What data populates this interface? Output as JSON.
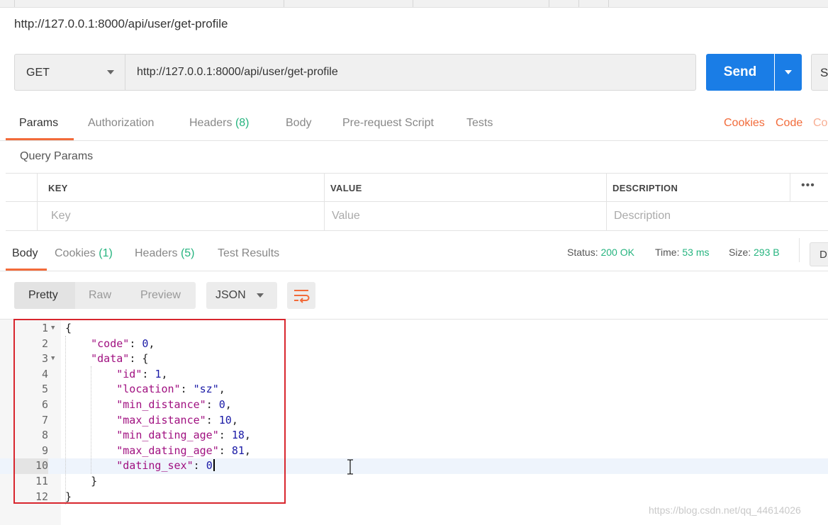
{
  "request": {
    "title": "http://127.0.0.1:8000/api/user/get-profile",
    "method": "GET",
    "url": "http://127.0.0.1:8000/api/user/get-profile",
    "send_label": "Send",
    "save_label_partial": "Sa"
  },
  "request_tabs": [
    {
      "label": "Params",
      "count": ""
    },
    {
      "label": "Authorization",
      "count": ""
    },
    {
      "label": "Headers",
      "count": "(8)"
    },
    {
      "label": "Body",
      "count": ""
    },
    {
      "label": "Pre-request Script",
      "count": ""
    },
    {
      "label": "Tests",
      "count": ""
    }
  ],
  "request_links": {
    "cookies": "Cookies",
    "code": "Code",
    "partial": "Co"
  },
  "query_params": {
    "title": "Query Params",
    "headers": [
      "KEY",
      "VALUE",
      "DESCRIPTION"
    ],
    "placeholders": [
      "Key",
      "Value",
      "Description"
    ],
    "more": "•••"
  },
  "response_tabs": [
    {
      "label": "Body",
      "count": ""
    },
    {
      "label": "Cookies",
      "count": "(1)"
    },
    {
      "label": "Headers",
      "count": "(5)"
    },
    {
      "label": "Test Results",
      "count": ""
    }
  ],
  "response_status": {
    "status_label": "Status:",
    "status_value": "200 OK",
    "time_label": "Time:",
    "time_value": "53 ms",
    "size_label": "Size:",
    "size_value": "293 B",
    "download_partial": "D"
  },
  "view_modes": [
    "Pretty",
    "Raw",
    "Preview"
  ],
  "format": "JSON",
  "icons": {
    "wrap": "wrap-lines-icon",
    "cursor": "text-cursor-icon"
  },
  "colors": {
    "accent": "#f26b3a",
    "send": "#1a7de6",
    "success": "#26b47f",
    "highlight_box": "#d8262e"
  },
  "code_lines": [
    {
      "n": "1",
      "fold": true
    },
    {
      "n": "2"
    },
    {
      "n": "3",
      "fold": true
    },
    {
      "n": "4"
    },
    {
      "n": "5"
    },
    {
      "n": "6"
    },
    {
      "n": "7"
    },
    {
      "n": "8"
    },
    {
      "n": "9"
    },
    {
      "n": "10"
    },
    {
      "n": "11"
    },
    {
      "n": "12"
    }
  ],
  "response_json": {
    "code_key": "\"code\"",
    "code_val": "0",
    "data_key": "\"data\"",
    "id_key": "\"id\"",
    "id_val": "1",
    "location_key": "\"location\"",
    "location_val": "\"sz\"",
    "min_distance_key": "\"min_distance\"",
    "min_distance_val": "0",
    "max_distance_key": "\"max_distance\"",
    "max_distance_val": "10",
    "min_dating_age_key": "\"min_dating_age\"",
    "min_dating_age_val": "18",
    "max_dating_age_key": "\"max_dating_age\"",
    "max_dating_age_val": "81",
    "dating_sex_key": "\"dating_sex\"",
    "dating_sex_val": "0"
  },
  "watermark": "https://blog.csdn.net/qq_44614026"
}
